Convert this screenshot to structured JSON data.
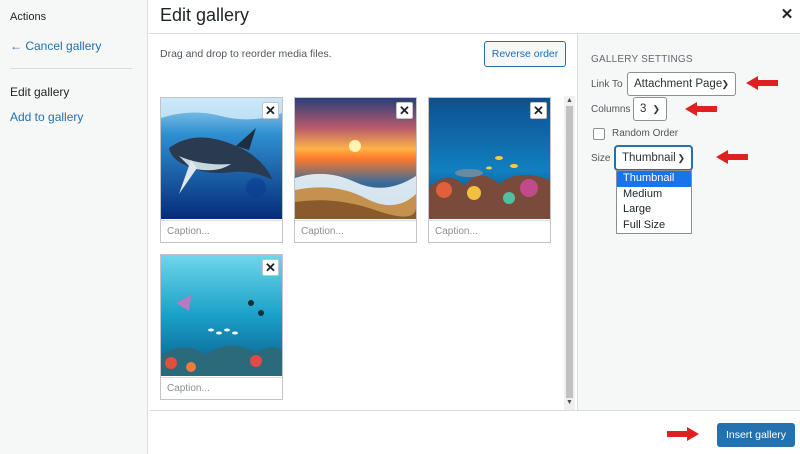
{
  "sidebar": {
    "heading": "Actions",
    "cancel_link": "← Cancel gallery",
    "current": "Edit gallery",
    "add_link": "Add to gallery"
  },
  "header": {
    "title": "Edit gallery",
    "close": "✕"
  },
  "main": {
    "instructions": "Drag and drop to reorder media files.",
    "reverse_button": "Reverse order",
    "attachments": [
      {
        "subject": "humpback whale underwater",
        "caption_placeholder": "Caption...",
        "remove": "✕"
      },
      {
        "subject": "ocean sunset beach wave",
        "caption_placeholder": "Caption...",
        "remove": "✕"
      },
      {
        "subject": "coral reef with fish",
        "caption_placeholder": "Caption...",
        "remove": "✕"
      },
      {
        "subject": "underwater scene with fish and diver",
        "caption_placeholder": "Caption...",
        "remove": "✕"
      }
    ]
  },
  "settings": {
    "heading": "GALLERY SETTINGS",
    "link_to_label": "Link To",
    "link_to_value": "Attachment Page",
    "columns_label": "Columns",
    "columns_value": "3",
    "random_order_label": "Random Order",
    "random_order_checked": false,
    "size_label": "Size",
    "size_value": "Thumbnail",
    "size_options": [
      "Thumbnail",
      "Medium",
      "Large",
      "Full Size"
    ]
  },
  "footer": {
    "insert_button": "Insert gallery"
  },
  "colors": {
    "accent": "#2271b1",
    "annotation_arrow": "#e02020",
    "dropdown_highlight": "#1a73e8"
  }
}
